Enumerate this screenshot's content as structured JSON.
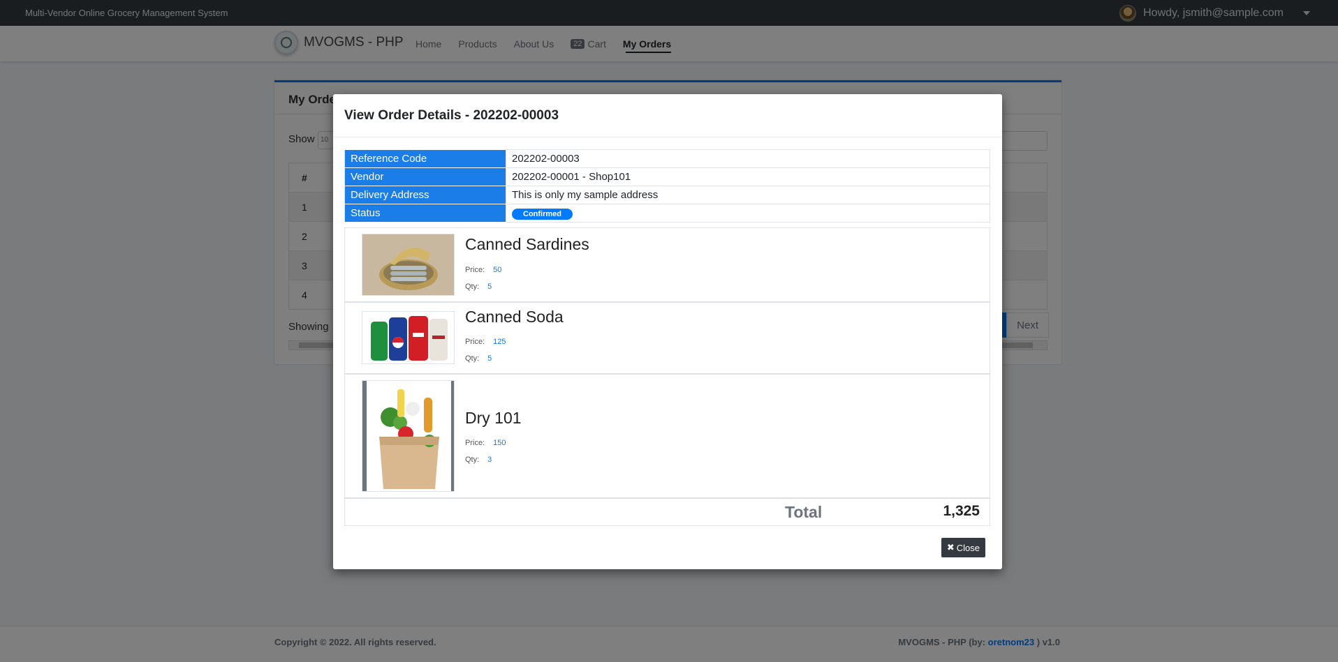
{
  "topbar": {
    "system_title": "Multi-Vendor Online Grocery Management System",
    "user_greeting": "Howdy, jsmith@sample.com"
  },
  "navbar": {
    "brand": "MVOGMS - PHP",
    "links": {
      "home": "Home",
      "products": "Products",
      "about": "About Us",
      "cart": "Cart",
      "orders": "My Orders"
    },
    "cart_count": "22"
  },
  "page": {
    "card_title": "My Orders",
    "show_label": "Show",
    "show_value": "10",
    "rows": [
      "1",
      "2",
      "3",
      "4"
    ],
    "showing_text": "Showing",
    "next_label": "Next"
  },
  "modal": {
    "title": "View Order Details - 202202-00003",
    "info": {
      "ref_label": "Reference Code",
      "ref_value": "202202-00003",
      "vendor_label": "Vendor",
      "vendor_value": "202202-00001 - Shop101",
      "address_label": "Delivery Address",
      "address_value": "This is only my sample address",
      "status_label": "Status",
      "status_value": "Confirmed"
    },
    "price_label": "Price:",
    "qty_label": "Qty:",
    "items": [
      {
        "name": "Canned Sardines",
        "price": "50",
        "qty": "5"
      },
      {
        "name": "Canned Soda",
        "price": "125",
        "qty": "5"
      },
      {
        "name": "Dry 101",
        "price": "150",
        "qty": "3"
      }
    ],
    "total_label": "Total",
    "total_value": "1,325",
    "close_label": "Close"
  },
  "footer": {
    "copyright": "Copyright © 2022. All rights reserved.",
    "credit_prefix": "MVOGMS - PHP (by: ",
    "credit_author": "oretnom23",
    "credit_suffix": " ) v1.0"
  },
  "colors": {
    "primary": "#007bff",
    "label_bg": "#1a7de8",
    "dark": "#343a40"
  }
}
